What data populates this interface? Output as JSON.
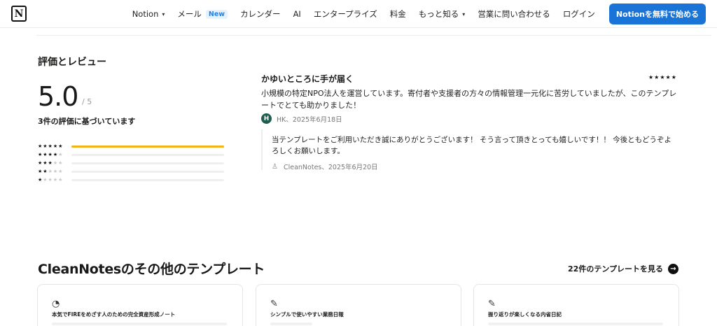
{
  "nav": {
    "logo_letter": "N",
    "items": [
      {
        "label": "Notion",
        "dropdown": true
      },
      {
        "label": "メール",
        "badge": "New"
      },
      {
        "label": "カレンダー"
      },
      {
        "label": "AI"
      },
      {
        "label": "エンタープライズ"
      },
      {
        "label": "料金"
      },
      {
        "label": "もっと知る",
        "dropdown": true
      },
      {
        "label": "営業に問い合わせる"
      },
      {
        "label": "ログイン"
      }
    ],
    "cta": "Notionを無料で始める"
  },
  "ratings": {
    "title": "評価とレビュー",
    "score": "5.0",
    "out_of": "/ 5",
    "based_on": "3件の評価に基づいています",
    "distribution": [
      {
        "stars": 5,
        "fraction": 1.0
      },
      {
        "stars": 4,
        "fraction": 0
      },
      {
        "stars": 3,
        "fraction": 0
      },
      {
        "stars": 2,
        "fraction": 0
      },
      {
        "stars": 1,
        "fraction": 0
      }
    ],
    "colors": {
      "fill": "#f2b31b",
      "track": "#efefef"
    }
  },
  "review": {
    "title": "かゆいところに手が届く",
    "stars": "★★★★★",
    "body": "小規模の特定NPO法人を運営しています。寄付者や支援者の方々の情報管理一元化に苦労していましたが、このテンプレートでとても助かりました！",
    "avatar_letter": "H",
    "meta": "HK、2025年6月18日",
    "reply": {
      "body": "当テンプレートをご利用いただき誠にありがとうございます！ そう言って頂きとっても嬉しいです！！ 今後ともどうぞよろしくお願いします。",
      "meta": "CleanNotes、2025年6月20日"
    }
  },
  "more": {
    "title": "CleanNotesのその他のテンプレート",
    "see_all": "22件のテンプレートを見る",
    "cards": [
      {
        "icon": "chart-icon",
        "title": "本気でFIREをめざす人のための完全資産形成ノート"
      },
      {
        "icon": "edit-icon",
        "title": "シンプルで使いやすい業務日報"
      },
      {
        "icon": "edit-icon",
        "title": "振り返りが楽しくなる内省日記"
      }
    ]
  }
}
